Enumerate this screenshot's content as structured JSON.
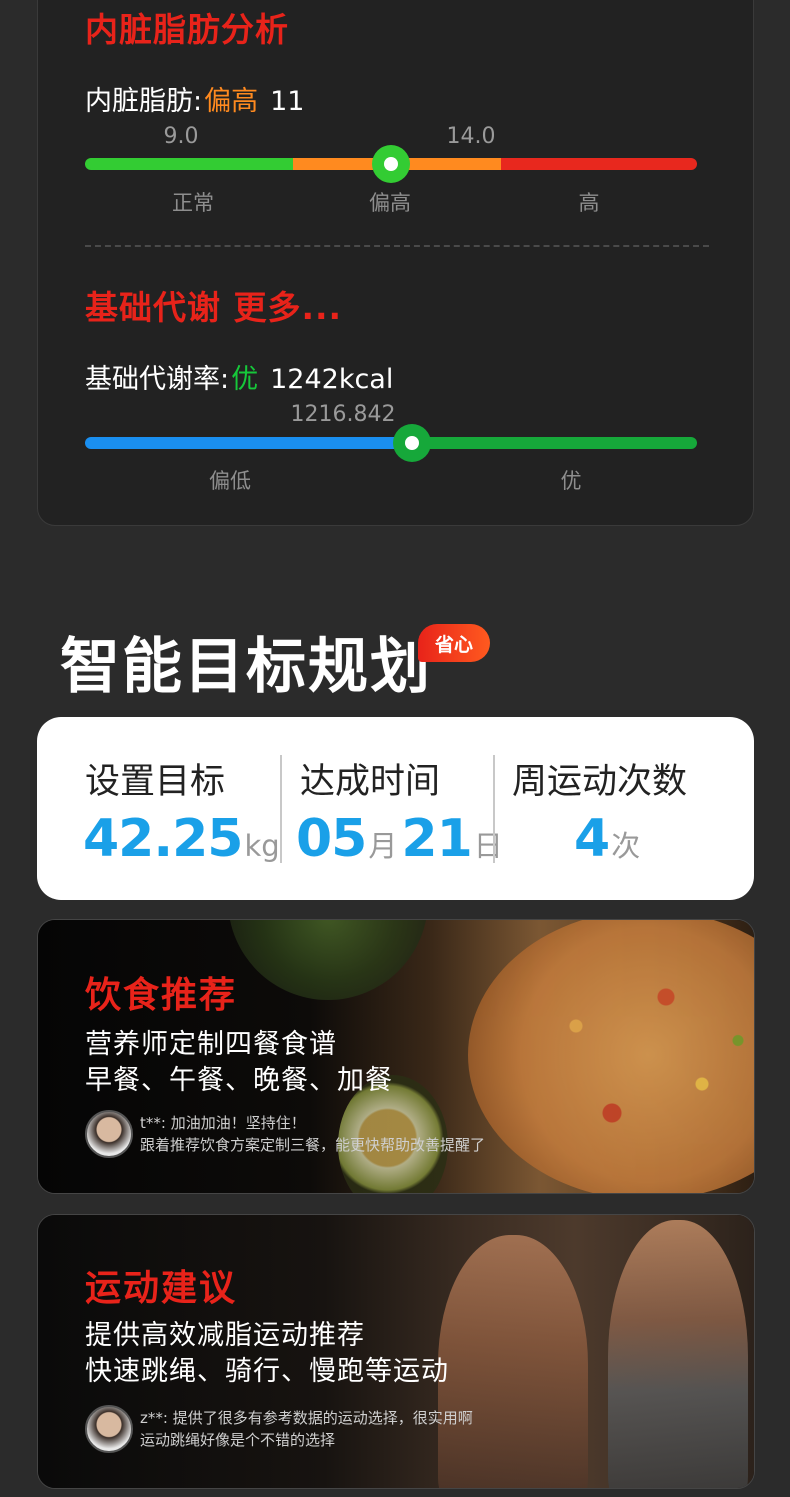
{
  "visceral": {
    "title": "内脏脂肪分析",
    "label": "内脏脂肪:",
    "level": "偏高",
    "value": "11",
    "ticks": [
      "9.0",
      "14.0"
    ],
    "zones": [
      "正常",
      "偏高",
      "高"
    ],
    "indicator_value": 11,
    "range": [
      5,
      19
    ],
    "colors": {
      "normal": "#33cc33",
      "high": "#ff8a1f",
      "very_high": "#e8281e",
      "level": "#ff8a1f"
    }
  },
  "bmr": {
    "title": "基础代谢 更多...",
    "label": "基础代谢率:",
    "level": "优",
    "value": "1242kcal",
    "tick": "1216.842",
    "zones": [
      "偏低",
      "优"
    ],
    "indicator_value": 1242,
    "colors": {
      "low": "#1a8ff0",
      "good": "#16a83a",
      "level": "#16c83a"
    }
  },
  "goal": {
    "title": "智能目标规划",
    "badge": "省心",
    "columns": [
      {
        "label": "设置目标",
        "value": "42.25",
        "unit": "kg"
      },
      {
        "label": "达成时间",
        "month": "05",
        "month_unit": "月",
        "day": "21",
        "day_unit": "日"
      },
      {
        "label": "周运动次数",
        "value": "4",
        "unit": "次"
      }
    ],
    "accent": "#1aa0e8"
  },
  "food": {
    "title": "饮食推荐",
    "lines": [
      "营养师定制四餐食谱",
      "早餐、午餐、晚餐、加餐"
    ],
    "comment_user": "t**: 加油加油！坚持住！",
    "comment_text": "跟着推荐饮食方案定制三餐，能更快帮助改善提醒了",
    "icon": "avatar-photo"
  },
  "sport": {
    "title": "运动建议",
    "lines": [
      "提供高效减脂运动推荐",
      "快速跳绳、骑行、慢跑等运动"
    ],
    "comment_user": "z**: 提供了很多有参考数据的运动选择，很实用啊",
    "comment_text": "运动跳绳好像是个不错的选择",
    "icon": "avatar-photo"
  }
}
